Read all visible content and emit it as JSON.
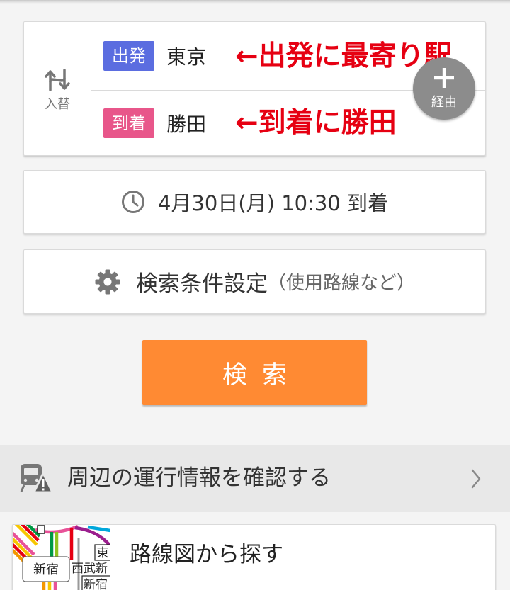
{
  "route_card": {
    "swap_label": "入替",
    "departure": {
      "badge": "出発",
      "station": "東京",
      "note": "←出発に最寄り駅"
    },
    "arrival": {
      "badge": "到着",
      "station": "勝田",
      "note": "←到着に勝田"
    },
    "via_label": "経由"
  },
  "datetime_card": {
    "text": "4月30日(月) 10:30 到着"
  },
  "conditions_card": {
    "label": "検索条件設定",
    "hint": "（使用路線など）"
  },
  "search_button": {
    "label": "検索"
  },
  "service_info": {
    "label": "周辺の運行情報を確認する"
  },
  "route_map": {
    "label": "路線図から探す",
    "map_labels": {
      "station_box": "新宿",
      "east": "東",
      "seibu": "西武新",
      "station_bottom": "新宿"
    }
  },
  "colors": {
    "departure_badge": "#5b6de0",
    "arrival_badge": "#e8568a",
    "annotation": "#e60012",
    "search_button": "#ff8a33",
    "via_button": "#8c8c8c",
    "icon_gray": "#777777"
  },
  "icons": {
    "swap": "swap-icon",
    "via": "plus-icon",
    "datetime": "clock-icon",
    "conditions": "gear-icon",
    "service_info": "train-warning-icon",
    "service_info_arrow": "chevron-right-icon"
  }
}
